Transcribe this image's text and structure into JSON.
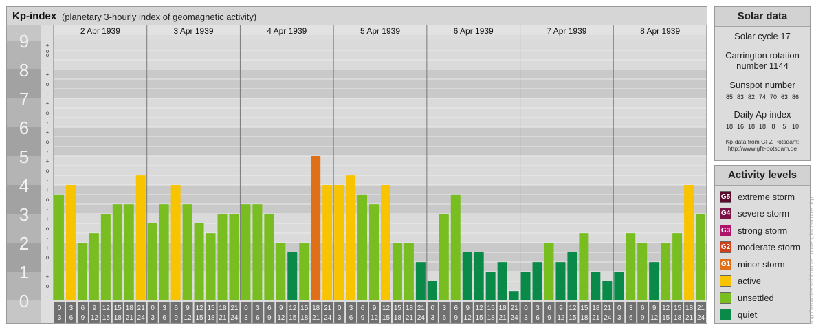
{
  "header": {
    "title": "Kp-index",
    "subtitle": "(planetary 3-hourly index of geomagnetic activity)"
  },
  "solar": {
    "title": "Solar data",
    "cycle": "Solar cycle 17",
    "carrington_1": "Carrington rotation",
    "carrington_2": "number 1144",
    "sunspot_label": "Sunspot number",
    "sunspot_values": [
      "85",
      "83",
      "82",
      "74",
      "70",
      "63",
      "86"
    ],
    "ap_label": "Daily Ap-index",
    "ap_values": [
      "18",
      "16",
      "18",
      "18",
      "8",
      "5",
      "10"
    ],
    "source_1": "Kp-data from GFZ Potsdam:",
    "source_2": "http://www.gfz-potsdam.de"
  },
  "activity": {
    "title": "Activity levels",
    "levels": [
      {
        "badge": "G5",
        "label": "extreme storm",
        "color": "#5a0a2a"
      },
      {
        "badge": "G4",
        "label": "severe storm",
        "color": "#7a1246"
      },
      {
        "badge": "G3",
        "label": "strong storm",
        "color": "#b0136a"
      },
      {
        "badge": "G2",
        "label": "moderate storm",
        "color": "#d0401a"
      },
      {
        "badge": "G1",
        "label": "minor storm",
        "color": "#e07018"
      },
      {
        "badge": "",
        "label": "active",
        "color": "#f8c400"
      },
      {
        "badge": "",
        "label": "unsettled",
        "color": "#78be20"
      },
      {
        "badge": "",
        "label": "quiet",
        "color": "#0a8a48"
      }
    ]
  },
  "watermark": "http://www.theusefulminute.com/english/archive.php",
  "chart_data": {
    "type": "bar",
    "title": "Kp-index",
    "ylim": [
      0,
      9
    ],
    "y_ticks": [
      "0",
      "1",
      "2",
      "3",
      "4",
      "5",
      "6",
      "7",
      "8",
      "9"
    ],
    "minor_ticks": [
      "-",
      "o",
      "+"
    ],
    "days": [
      "2 Apr 1939",
      "3 Apr 1939",
      "4 Apr 1939",
      "5 Apr 1939",
      "6 Apr 1939",
      "7 Apr 1939",
      "8 Apr 1939"
    ],
    "interval_start": [
      "0",
      "3",
      "6",
      "9",
      "12",
      "15",
      "18",
      "21"
    ],
    "interval_end": [
      "3",
      "6",
      "9",
      "12",
      "15",
      "18",
      "21",
      "24"
    ],
    "values": [
      [
        3.67,
        4.0,
        2.0,
        2.33,
        3.0,
        3.33,
        3.33,
        4.33
      ],
      [
        2.67,
        3.33,
        4.0,
        3.33,
        2.67,
        2.33,
        3.0,
        3.0
      ],
      [
        3.33,
        3.33,
        3.0,
        2.0,
        1.67,
        2.0,
        5.0,
        4.0
      ],
      [
        4.0,
        4.33,
        3.67,
        3.33,
        4.0,
        2.0,
        2.0,
        1.33
      ],
      [
        0.67,
        3.0,
        3.67,
        1.67,
        1.67,
        1.0,
        1.33,
        0.33
      ],
      [
        1.0,
        1.33,
        2.0,
        1.33,
        1.67,
        2.33,
        1.0,
        0.67
      ],
      [
        1.0,
        2.33,
        2.0,
        1.33,
        2.0,
        2.33,
        4.0,
        3.0
      ]
    ],
    "colors": {
      "quiet": "#0a8a48",
      "unsettled": "#78be20",
      "active": "#f8c400",
      "minor_storm": "#e07018"
    }
  }
}
